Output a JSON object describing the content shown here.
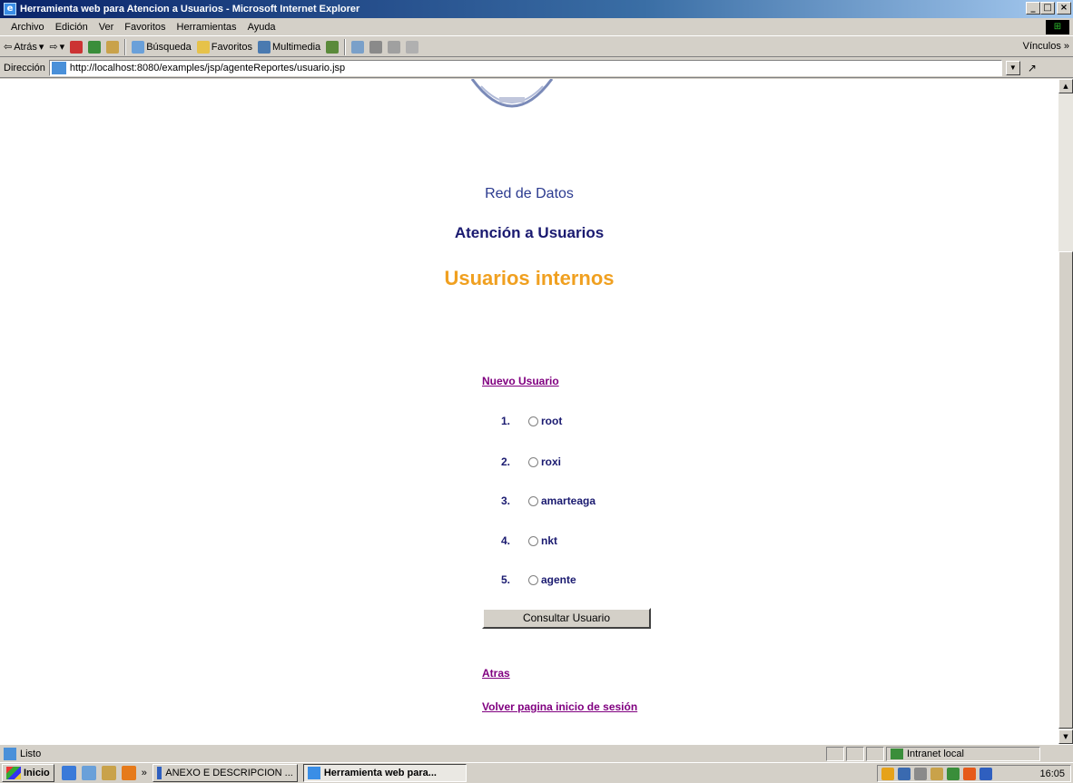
{
  "window": {
    "title": "Herramienta web para Atencion a Usuarios - Microsoft Internet Explorer",
    "controls": [
      "_",
      "□",
      "×"
    ]
  },
  "menu": [
    "Archivo",
    "Edición",
    "Ver",
    "Favoritos",
    "Herramientas",
    "Ayuda"
  ],
  "toolbar": {
    "back_label": "Atrás",
    "search_label": "Búsqueda",
    "favorites_label": "Favoritos",
    "multimedia_label": "Multimedia",
    "links_label": "Vínculos »"
  },
  "address": {
    "label": "Dirección",
    "url": "http://localhost:8080/examples/jsp/agenteReportes/usuario.jsp"
  },
  "page": {
    "red_datos": "Red de Datos",
    "atencion": "Atención a Usuarios",
    "usuarios_internos": "Usuarios internos",
    "nuevo_usuario": "Nuevo Usuario",
    "users": [
      {
        "num": "1.",
        "name": "root"
      },
      {
        "num": "2.",
        "name": "roxi"
      },
      {
        "num": "3.",
        "name": "amarteaga"
      },
      {
        "num": "4.",
        "name": "nkt"
      },
      {
        "num": "5.",
        "name": "agente"
      }
    ],
    "consultar_label": "Consultar Usuario",
    "atras": "Atras",
    "volver": "Volver pagina inicio de sesión"
  },
  "status": {
    "text": "Listo",
    "zone": "Intranet local"
  },
  "taskbar": {
    "start_label": "Inicio",
    "chevron": "»",
    "tasks": [
      {
        "label": "ANEXO E DESCRIPCION ...",
        "active": false
      },
      {
        "label": "Herramienta web para...",
        "active": true
      }
    ],
    "clock": "16:05"
  }
}
